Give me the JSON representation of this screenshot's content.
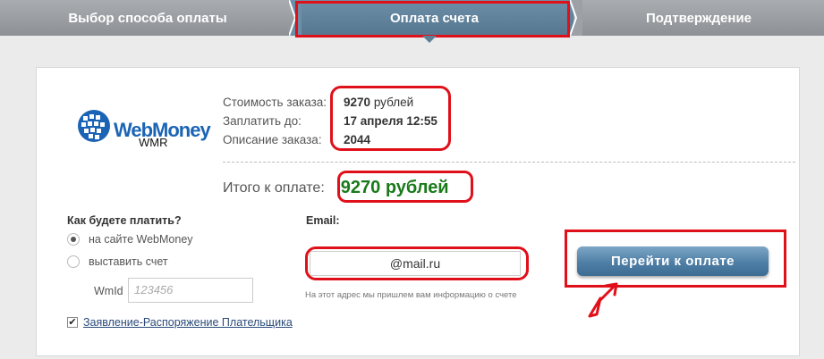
{
  "steps": [
    {
      "label": "Выбор способа оплаты"
    },
    {
      "label": "Оплата счета"
    },
    {
      "label": "Подтверждение"
    }
  ],
  "logo": {
    "wordmark": "WebMoney",
    "purse": "WMR"
  },
  "order": {
    "cost_label": "Стоимость заказа:",
    "cost_value": "9270",
    "cost_unit": "рублей",
    "due_label": "Заплатить до:",
    "due_value": "17 апреля 12:55",
    "desc_label": "Описание заказа:",
    "desc_value": "2044"
  },
  "total": {
    "label": "Итого к оплате:",
    "value": "9270 рублей"
  },
  "payment_method": {
    "title": "Как будете платить?",
    "options": [
      "на сайте WebMoney",
      "выставить счет"
    ],
    "selected": "на сайте WebMoney",
    "wmid_label": "WmId",
    "wmid_placeholder": "123456"
  },
  "email": {
    "title": "Email:",
    "value": "@mail.ru",
    "hint": "На этот адрес мы пришлем вам информацию о счете"
  },
  "pay_button": {
    "label": "Перейти к оплате"
  },
  "agreement": {
    "label": "Заявление-Распоряжение Плательщика",
    "checked": true
  },
  "colors": {
    "highlight": "#e0101a",
    "active_step": "#5f7f97",
    "total_green": "#1a7a1a",
    "logo_blue": "#1b64b5"
  }
}
